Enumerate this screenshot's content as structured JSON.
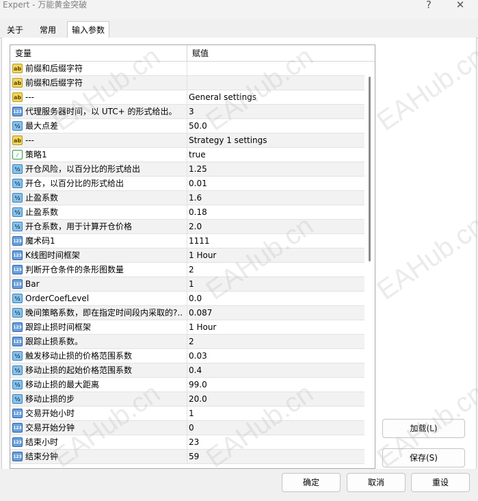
{
  "window": {
    "title": "Expert - 万能黄金突破",
    "help": "?",
    "close": "✕"
  },
  "tabs": [
    {
      "label": "关于"
    },
    {
      "label": "常用"
    },
    {
      "label": "输入参数"
    }
  ],
  "grid": {
    "col_variable": "变量",
    "col_value": "赋值",
    "rows": [
      {
        "icon": "ab",
        "name": "前缀和后缀字符",
        "value": ""
      },
      {
        "icon": "ab",
        "name": "前缀和后缀字符",
        "value": ""
      },
      {
        "icon": "ab",
        "name": "---",
        "value": "General settings"
      },
      {
        "icon": "123",
        "name": "代理服务器时间，以 UTC+ 的形式给出。",
        "value": "3"
      },
      {
        "icon": "v2",
        "name": "最大点差",
        "value": "50.0"
      },
      {
        "icon": "ab",
        "name": "---",
        "value": "Strategy 1 settings"
      },
      {
        "icon": "sw",
        "name": "策略1",
        "value": "true"
      },
      {
        "icon": "v2",
        "name": "开仓风险，以百分比的形式给出",
        "value": "1.25"
      },
      {
        "icon": "v2",
        "name": "开仓，以百分比的形式给出",
        "value": "0.01"
      },
      {
        "icon": "v2",
        "name": "止盈系数",
        "value": "1.6"
      },
      {
        "icon": "v2",
        "name": "止盈系数",
        "value": "0.18"
      },
      {
        "icon": "v2",
        "name": "开仓系数，用于计算开仓价格",
        "value": "2.0"
      },
      {
        "icon": "123",
        "name": "魔术码1",
        "value": "1111"
      },
      {
        "icon": "123",
        "name": "K线图时间框架",
        "value": "1 Hour"
      },
      {
        "icon": "123",
        "name": "判断开仓条件的条形图数量",
        "value": "2"
      },
      {
        "icon": "123",
        "name": "Bar",
        "value": "1"
      },
      {
        "icon": "v2",
        "name": "OrderCoefLevel",
        "value": "0.0"
      },
      {
        "icon": "v2",
        "name": "晚间策略系数，即在指定时间段内采取的?..",
        "value": "0.087"
      },
      {
        "icon": "123",
        "name": "跟踪止损时间框架",
        "value": "1 Hour"
      },
      {
        "icon": "123",
        "name": "跟踪止损系数。",
        "value": "2"
      },
      {
        "icon": "v2",
        "name": "触发移动止损的价格范围系数",
        "value": "0.03"
      },
      {
        "icon": "v2",
        "name": "移动止损的起始价格范围系数",
        "value": "0.4"
      },
      {
        "icon": "v2",
        "name": "移动止损的最大距离",
        "value": "99.0"
      },
      {
        "icon": "v2",
        "name": "移动止损的步",
        "value": "20.0"
      },
      {
        "icon": "123",
        "name": "交易开始小时",
        "value": "1"
      },
      {
        "icon": "123",
        "name": "交易开始分钟",
        "value": "0"
      },
      {
        "icon": "123",
        "name": "结束小时",
        "value": "23"
      },
      {
        "icon": "123",
        "name": "结束分钟",
        "value": "59"
      }
    ]
  },
  "icon_text": {
    "ab": "ab",
    "123": "123",
    "v2": "½",
    "sw": "⁄"
  },
  "buttons": {
    "load": "加载(L)",
    "save": "保存(S)",
    "ok": "确定",
    "cancel": "取消",
    "reset": "重设"
  },
  "watermark": "EAHub.cn"
}
